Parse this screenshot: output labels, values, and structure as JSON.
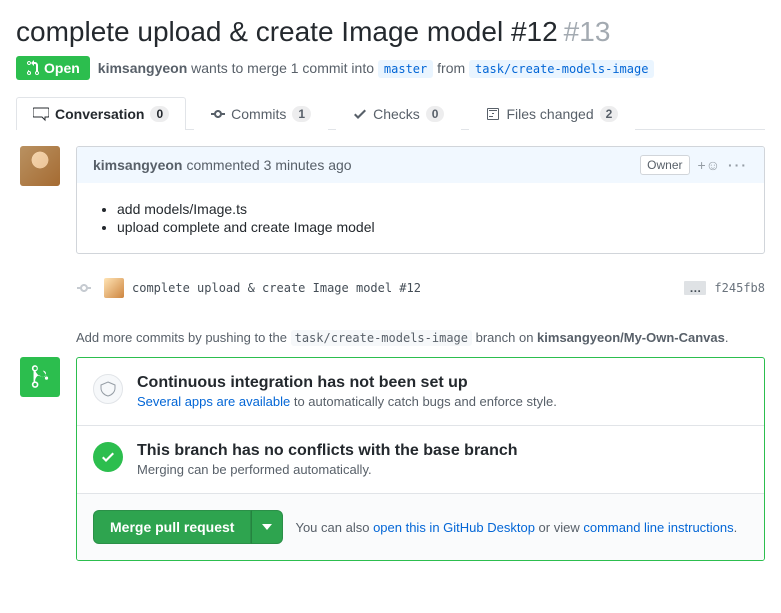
{
  "header": {
    "title": "complete upload & create Image model #12",
    "number": "#13",
    "state": "Open",
    "author": "kimsangyeon",
    "meta_prefix": " wants to merge 1 commit into ",
    "base_branch": "master",
    "meta_middle": " from ",
    "head_branch": "task/create-models-image"
  },
  "tabs": {
    "conversation": {
      "label": "Conversation",
      "count": "0"
    },
    "commits": {
      "label": "Commits",
      "count": "1"
    },
    "checks": {
      "label": "Checks",
      "count": "0"
    },
    "files": {
      "label": "Files changed",
      "count": "2"
    }
  },
  "comment": {
    "author": "kimsangyeon",
    "verb": " commented ",
    "time": "3 minutes ago",
    "badge": "Owner",
    "bullets": [
      "add models/Image.ts",
      "upload complete and create Image model"
    ]
  },
  "commit": {
    "message": "complete upload & create Image model #12",
    "sha": "f245fb8"
  },
  "push_hint": {
    "prefix": "Add more commits by pushing to the ",
    "branch": "task/create-models-image",
    "middle": " branch on ",
    "repo": "kimsangyeon/My-Own-Canvas",
    "suffix": "."
  },
  "merge": {
    "ci_title": "Continuous integration has not been set up",
    "ci_link": "Several apps are available",
    "ci_rest": " to automatically catch bugs and enforce style.",
    "ok_title": "This branch has no conflicts with the base branch",
    "ok_sub": "Merging can be performed automatically.",
    "button": "Merge pull request",
    "footer_prefix": "You can also ",
    "footer_link1": "open this in GitHub Desktop",
    "footer_mid": " or view ",
    "footer_link2": "command line instructions",
    "footer_suffix": "."
  }
}
